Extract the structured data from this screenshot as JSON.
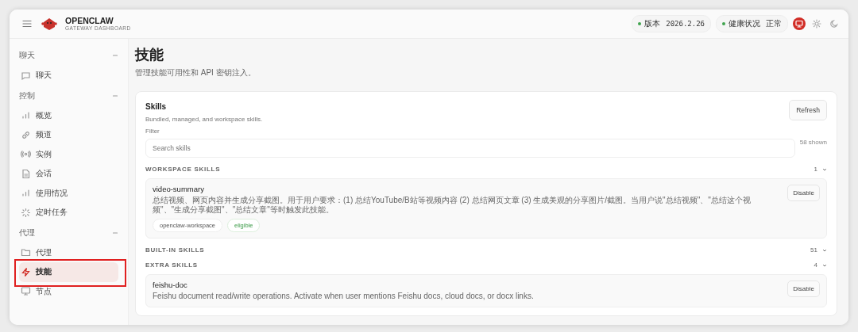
{
  "brand": {
    "name": "OPENCLAW",
    "subtitle": "GATEWAY DASHBOARD"
  },
  "status_pills": [
    {
      "label": "版本",
      "value": "2026.2.26",
      "color": "#3fa34d"
    },
    {
      "label": "健康状况",
      "value": "正常",
      "color": "#3fa34d"
    }
  ],
  "theme_options": [
    {
      "selected": true
    },
    {
      "selected": false
    },
    {
      "selected": false
    }
  ],
  "sidebar": {
    "groups": [
      {
        "label": "聊天",
        "items": [
          {
            "label": "聊天",
            "selected": false
          }
        ]
      },
      {
        "label": "控制",
        "items": [
          {
            "label": "概览",
            "selected": false
          },
          {
            "label": "频道",
            "selected": false
          },
          {
            "label": "实例",
            "selected": false
          },
          {
            "label": "会话",
            "selected": false
          },
          {
            "label": "使用情况",
            "selected": false
          },
          {
            "label": "定时任务",
            "selected": false
          }
        ]
      },
      {
        "label": "代理",
        "items": [
          {
            "label": "代理",
            "selected": false
          },
          {
            "label": "技能",
            "selected": true
          },
          {
            "label": "节点",
            "selected": false
          }
        ]
      }
    ]
  },
  "page": {
    "title": "技能",
    "subtitle": "管理技能可用性和 API 密钥注入。"
  },
  "card": {
    "title": "Skills",
    "subtitle": "Bundled, managed, and workspace skills.",
    "refresh_button": "Refresh",
    "filter_label": "Filter",
    "search": {
      "placeholder": "Search skills"
    },
    "shown_count": "58 shown",
    "sections": [
      {
        "title": "WORKSPACE SKILLS",
        "count": "1",
        "skills": [
          {
            "name": "video-summary",
            "description": "总结视频、网页内容并生成分享截图。用于用户要求：(1) 总结YouTube/B站等视频内容 (2) 总结网页文章 (3) 生成美观的分享图片/截图。当用户说\"总结视频\"、\"总结这个视频\"、\"生成分享截图\"、\"总结文章\"等时触发此技能。",
            "tags": [
              {
                "label": "openclaw-workspace",
                "kind": "source"
              },
              {
                "label": "eligible",
                "kind": "status"
              }
            ],
            "button": "Disable"
          }
        ]
      },
      {
        "title": "BUILT-IN SKILLS",
        "count": "51"
      },
      {
        "title": "EXTRA SKILLS",
        "count": "4",
        "skills": [
          {
            "name": "feishu-doc",
            "description": "Feishu document read/write operations. Activate when user mentions Feishu docs, cloud docs, or docx links.",
            "button": "Disable"
          }
        ]
      }
    ]
  }
}
